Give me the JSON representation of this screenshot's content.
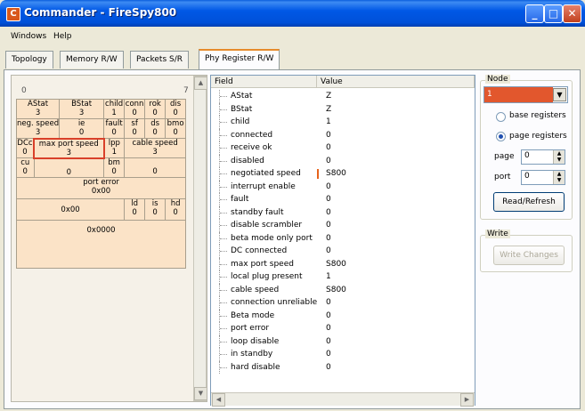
{
  "window": {
    "title": "Commander - FireSpy800",
    "app_icon": "C"
  },
  "menu": [
    "Windows",
    "Help"
  ],
  "tabs": [
    {
      "label": "Topology",
      "active": false
    },
    {
      "label": "Memory R/W",
      "active": false
    },
    {
      "label": "Packets S/R",
      "active": false
    },
    {
      "label": "Phy Register R/W",
      "active": true
    }
  ],
  "register_grid": {
    "bit_left": "0",
    "bit_right": "7",
    "cells": {
      "astat": [
        "AStat",
        "3"
      ],
      "bstat": [
        "BStat",
        "3"
      ],
      "child": [
        "child",
        "1"
      ],
      "conn": [
        "conn",
        "0"
      ],
      "rok": [
        "rok",
        "0"
      ],
      "dis": [
        "dis",
        "0"
      ],
      "neg_speed": [
        "neg. speed",
        "3"
      ],
      "ie": [
        "ie",
        "0"
      ],
      "fault": [
        "fault",
        "0"
      ],
      "sf": [
        "sf",
        "0"
      ],
      "ds": [
        "ds",
        "0"
      ],
      "bmo": [
        "bmo",
        "0"
      ],
      "dcc": [
        "DCc",
        "0"
      ],
      "max_port_speed": [
        "max port speed",
        "3"
      ],
      "lpp": [
        "lpp",
        "1"
      ],
      "cable_speed": [
        "cable speed",
        "3"
      ],
      "cu": [
        "cu",
        "0"
      ],
      "blank1": [
        "",
        "0"
      ],
      "bm": [
        "bm",
        "0"
      ],
      "blank2": [
        "",
        "0"
      ],
      "port_error": [
        "port error",
        "0x00"
      ],
      "blank3": [
        "",
        "0x00"
      ],
      "ld": [
        "ld",
        "0"
      ],
      "is": [
        "is",
        "0"
      ],
      "hd": [
        "hd",
        "0"
      ],
      "word": [
        "",
        "0x0000"
      ]
    }
  },
  "fields": {
    "header_field": "Field",
    "header_value": "Value",
    "rows": [
      {
        "field": "AStat",
        "value": "Z"
      },
      {
        "field": "BStat",
        "value": "Z"
      },
      {
        "field": "child",
        "value": "1"
      },
      {
        "field": "connected",
        "value": "0"
      },
      {
        "field": "receive ok",
        "value": "0"
      },
      {
        "field": "disabled",
        "value": "0"
      },
      {
        "field": "negotiated speed",
        "value": "S800"
      },
      {
        "field": "interrupt enable",
        "value": "0"
      },
      {
        "field": "fault",
        "value": "0"
      },
      {
        "field": "standby fault",
        "value": "0"
      },
      {
        "field": "disable scrambler",
        "value": "0"
      },
      {
        "field": "beta mode only port",
        "value": "0"
      },
      {
        "field": "DC connected",
        "value": "0"
      },
      {
        "field": "max port speed",
        "value": "S800"
      },
      {
        "field": "local plug present",
        "value": "1"
      },
      {
        "field": "cable speed",
        "value": "S800"
      },
      {
        "field": "connection unreliable",
        "value": "0"
      },
      {
        "field": "Beta mode",
        "value": "0"
      },
      {
        "field": "port error",
        "value": "0"
      },
      {
        "field": "loop disable",
        "value": "0"
      },
      {
        "field": "in standby",
        "value": "0"
      },
      {
        "field": "hard disable",
        "value": "0"
      }
    ]
  },
  "node_panel": {
    "group_label": "Node",
    "selected": "1",
    "radio_base": "base registers",
    "radio_page": "page registers",
    "page_label": "page",
    "page_value": "0",
    "port_label": "port",
    "port_value": "0",
    "read_refresh": "Read/Refresh"
  },
  "write_panel": {
    "group_label": "Write",
    "write_changes": "Write Changes"
  },
  "colors": {
    "accent": "#e2572d",
    "cell_bg": "#fbe3c7",
    "title_blue": "#0058e6"
  }
}
